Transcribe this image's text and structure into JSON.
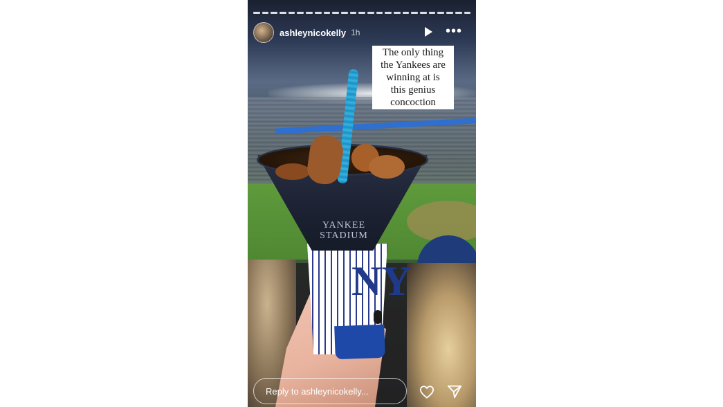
{
  "story": {
    "username": "ashleynicokelly",
    "time_ago": "1h",
    "progress_segments": 25,
    "caption_lines": [
      "The only thing",
      "the Yankees are",
      "winning at is",
      "this genius",
      "concoction"
    ],
    "reply_placeholder": "Reply to ashleynicokelly...",
    "icons": {
      "play": "play-icon",
      "more": "more-options-icon",
      "like": "heart-icon",
      "share": "send-icon"
    }
  },
  "photo": {
    "cup_text_line1": "YANKEE",
    "cup_text_line2": "STADIUM",
    "cup_logo": "NY",
    "accent_color": "#1e49a8",
    "straw_color": "#37b4e0"
  }
}
